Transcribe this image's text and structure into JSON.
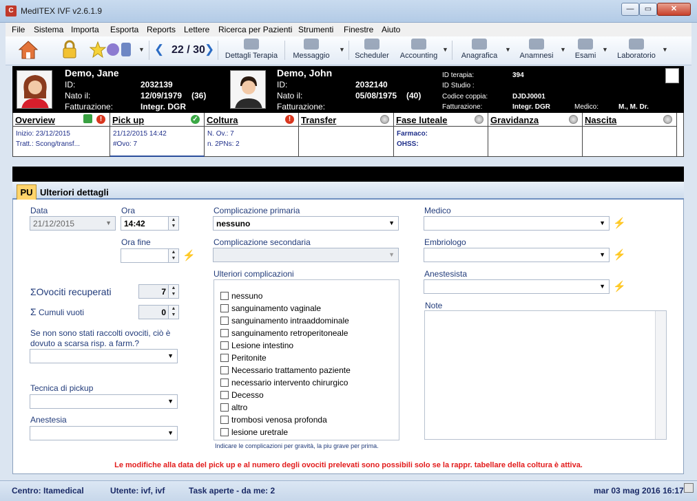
{
  "window": {
    "title": "MedITEX IVF v2.6.1.9",
    "app_icon": "C",
    "btn_min": "—",
    "btn_max": "▭",
    "btn_close": "✕"
  },
  "menu": [
    "File",
    "Sistema",
    "Importa",
    "Esporta",
    "Reports",
    "Lettere",
    "Ricerca per Pazienti",
    "Strumenti",
    "Finestre",
    "Aiuto"
  ],
  "toolbar": {
    "counter": "22 / 30",
    "prev_arrow": "❮",
    "next_arrow": "❯",
    "buttons": [
      "Dettagli Terapia",
      "Messaggio",
      "Scheduler",
      "Accounting",
      "Anagrafica",
      "Anamnesi",
      "Esami",
      "Laboratorio"
    ]
  },
  "female": {
    "name": "Demo, Jane",
    "id_label": "ID:",
    "id": "2032139",
    "born_label": "Nato il:",
    "born": "12/09/1979",
    "age": "(36)",
    "billing_label": "Fatturazione:",
    "billing": "Integr. DGR"
  },
  "male": {
    "name": "Demo, John",
    "id_label": "ID:",
    "id": "2032140",
    "born_label": "Nato il:",
    "born": "05/08/1975",
    "age": "(40)",
    "billing_label": "Fatturazione:",
    "billing": ""
  },
  "therapy": {
    "id_label": "ID terapia:",
    "id": "394",
    "study_label": "ID Studio :",
    "study": "",
    "couple_label": "Codice coppia:",
    "couple": "DJDJ0001",
    "billing_label": "Fatturazione:",
    "billing": "Integr. DGR",
    "doctor_label": "Medico:",
    "doctor": "M., M. Dr."
  },
  "phases": {
    "overview": {
      "title": "Overview",
      "line1": "Inizio: 23/12/2015",
      "line2": "Tratt.: Scong/transf..."
    },
    "pickup": {
      "title": "Pick up",
      "line1": "21/12/2015 14:42",
      "line2": "#Ovo: 7"
    },
    "coltura": {
      "title": "Coltura",
      "line1": "N. Ov.: 7",
      "line2": "n. 2PNs: 2"
    },
    "transfer": {
      "title": "Transfer"
    },
    "fase": {
      "title": "Fase luteale",
      "line1": "Farmaco:",
      "line2": "OHSS:"
    },
    "gravidanza": {
      "title": "Gravidanza"
    },
    "nascita": {
      "title": "Nascita"
    }
  },
  "tabs": {
    "active": "PU",
    "details": "Ulteriori dettagli"
  },
  "form": {
    "data_label": "Data",
    "data_value": "21/12/2015",
    "ora_label": "Ora",
    "ora_value": "14:42",
    "ora_fine_label": "Ora fine",
    "ora_fine_value": "",
    "ovociti_label": "Ovociti recuperati",
    "ovociti_value": "7",
    "cumuli_label": "Cumuli vuoti",
    "cumuli_value": "0",
    "sigma": "Σ",
    "scarsa_label_1": "Se non sono stati raccolti ovociti, ciò è",
    "scarsa_label_2": "dovuto a scarsa risp. a farm.?",
    "tecnica_label": "Tecnica di pickup",
    "anestesia_label": "Anestesia",
    "comp_primaria_label": "Complicazione primaria",
    "comp_primaria_value": "nessuno",
    "comp_secondaria_label": "Complicazione secondaria",
    "ulteriori_label": "Ulteriori complicazioni",
    "complicazioni": [
      "nessuno",
      "sanguinamento vaginale",
      "sanguinamento intraaddominale",
      "sanguinamento retroperitoneale",
      "Lesione intestino",
      "Peritonite",
      "Necessario trattamento paziente",
      "necessario intervento chirurgico",
      "Decesso",
      "altro",
      "trombosi venosa profonda",
      "lesione uretrale"
    ],
    "hint": "Indicare le complicazioni per gravità, la piu grave per prima.",
    "medico_label": "Medico",
    "embriologo_label": "Embriologo",
    "anestesista_label": "Anestesista",
    "note_label": "Note"
  },
  "warning": "Le modifiche alla data del pick up e al numero degli ovociti prelevati sono possibili solo se la rappr. tabellare della coltura è attiva.",
  "status": {
    "centro": "Centro: Itamedical",
    "utente": "Utente: ivf, ivf",
    "task": "Task aperte - da me: 2",
    "datetime": "mar 03 mag 2016 16:17"
  },
  "icons": {
    "bolt": "⚡",
    "dropdown": "▼",
    "spin_up": "▲",
    "spin_down": "▼",
    "red_dot": "!",
    "green_dot": "✓"
  }
}
